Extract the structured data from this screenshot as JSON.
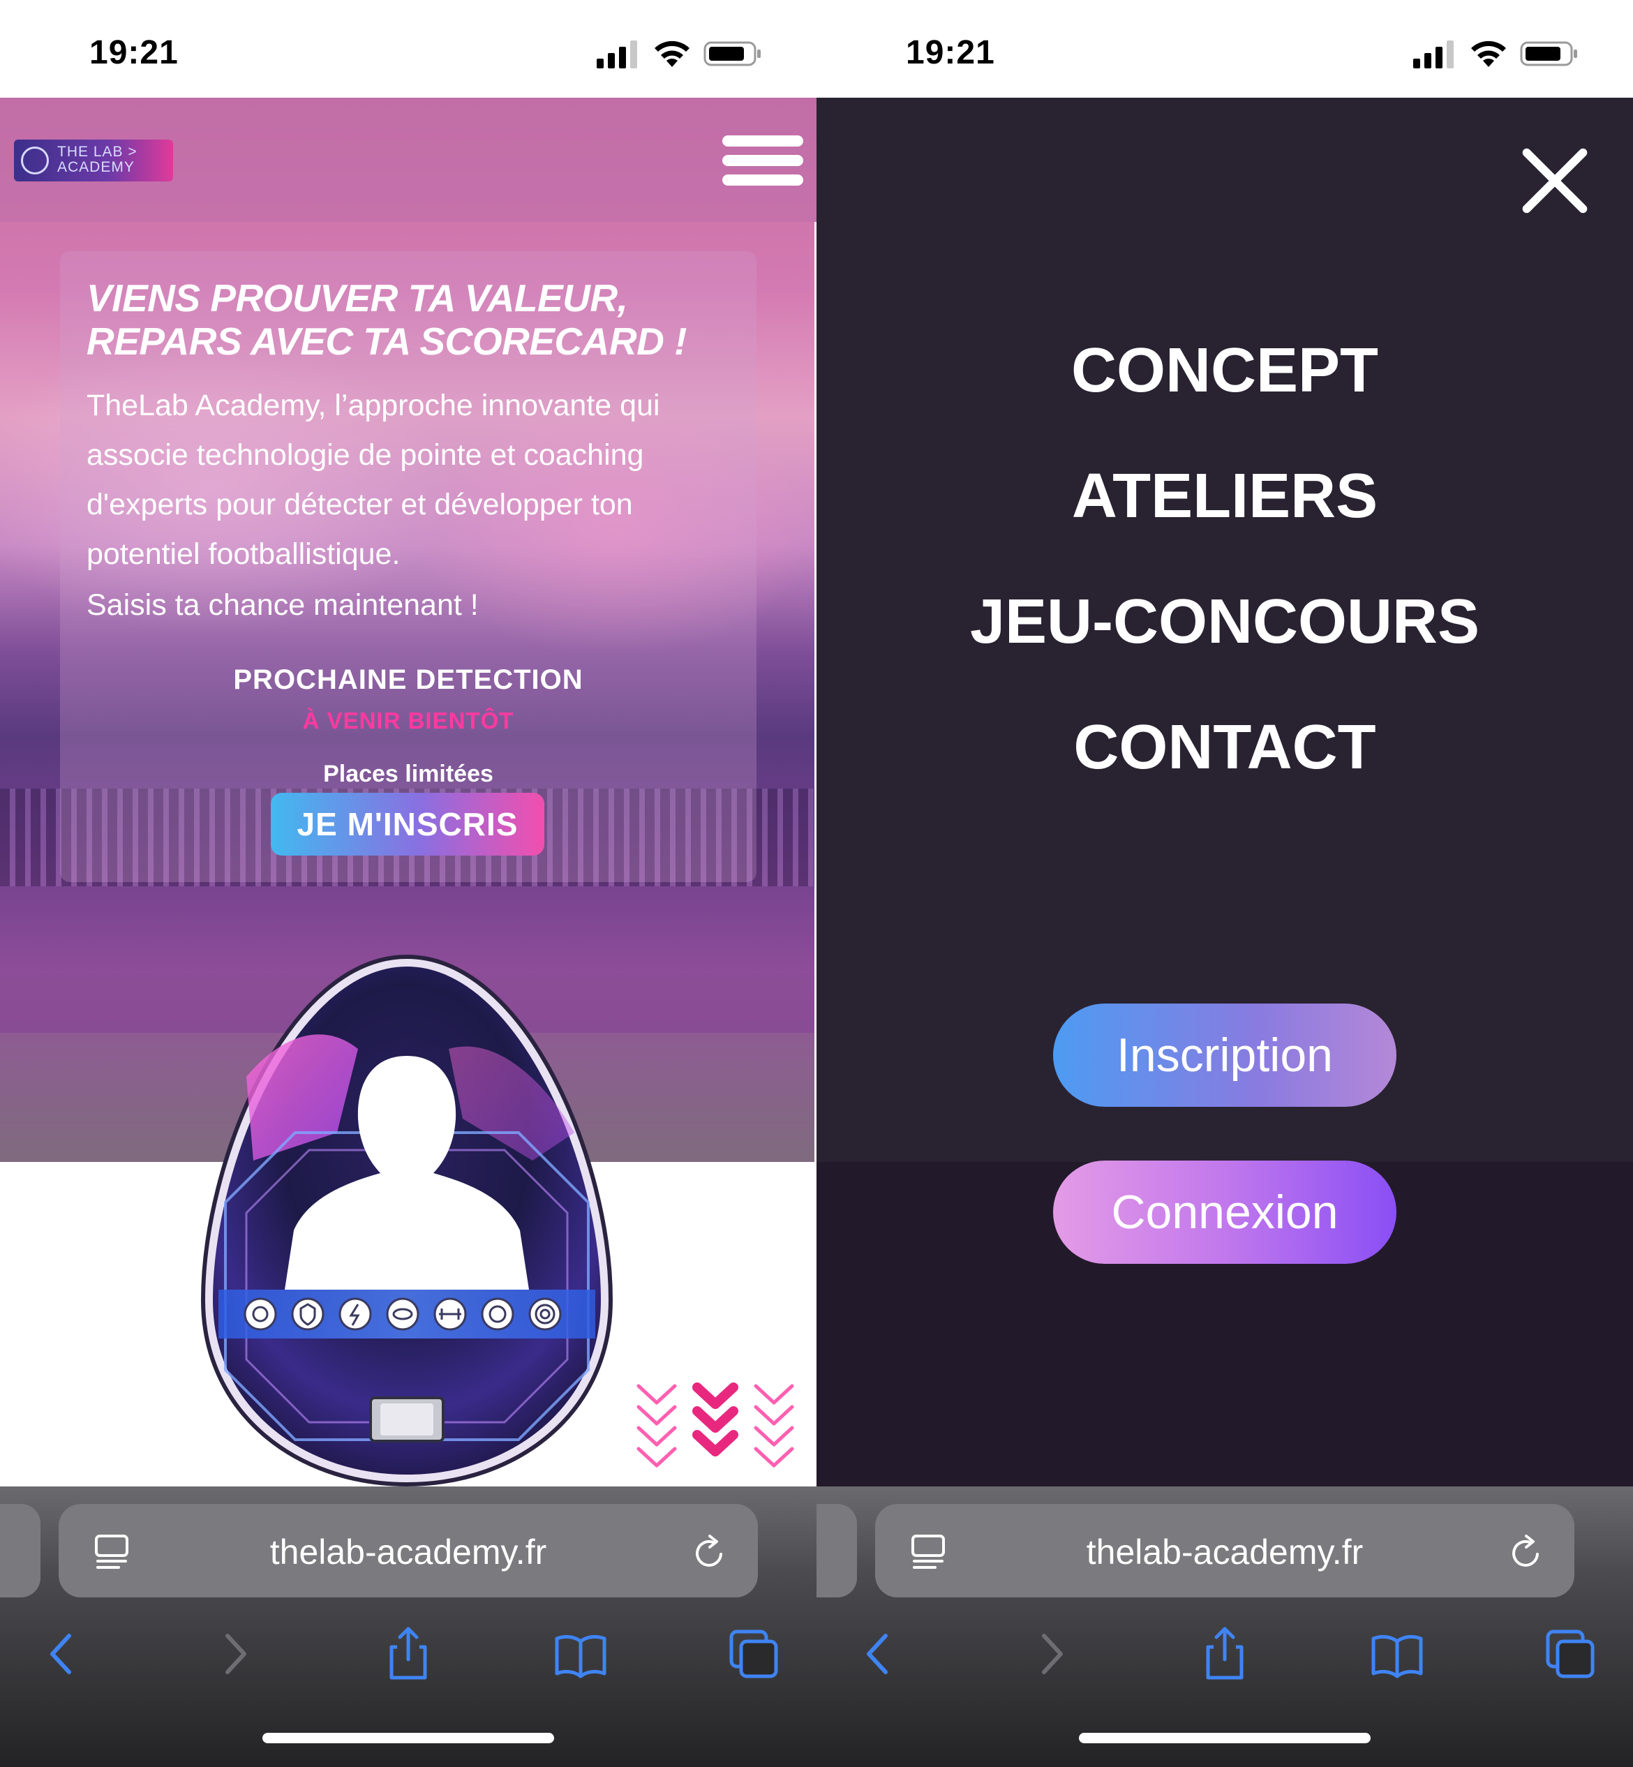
{
  "status_bar": {
    "time": "19:21"
  },
  "left": {
    "logo": {
      "line1": "THE LAB >",
      "line2": "ACADEMY"
    },
    "hero": {
      "headline": "VIENS PROUVER TA VALEUR, REPARS AVEC TA SCORECARD !",
      "description": "TheLab Academy, l’approche innovante qui associe technologie de pointe et coaching d'experts pour détecter et développer ton potentiel footballistique.",
      "call": "Saisis ta chance maintenant !",
      "next_detection_label": "PROCHAINE DETECTION",
      "next_detection_value": "À VENIR BIENTÔT",
      "places": "Places limitées",
      "cta": "JE M'INSCRIS"
    },
    "scorecard_icons": [
      "gear-icon",
      "shield-icon",
      "lightning-icon",
      "eye-icon",
      "dumbbell-icon",
      "soccer-ball-icon",
      "target-icon"
    ]
  },
  "right": {
    "menu": [
      "CONCEPT",
      "ATELIERS",
      "JEU-CONCOURS",
      "CONTACT"
    ],
    "inscription": "Inscription",
    "connexion": "Connexion"
  },
  "browser": {
    "url": "thelab-academy.fr"
  },
  "colors": {
    "accent_pink": "#ff3aa0",
    "cta_blue": "#42b9f0",
    "overlay": "#1c1424"
  }
}
